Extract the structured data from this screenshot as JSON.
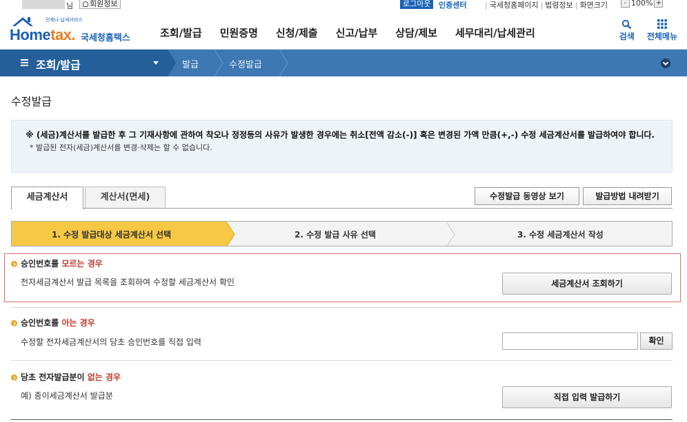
{
  "util": {
    "user_suffix": "님",
    "member_info": "회원정보",
    "logout": "로그아웃",
    "cert_center": "인증센터",
    "links": [
      "국세청홈페이지",
      "법령정보",
      "화면크기"
    ],
    "zoom_minus": "-",
    "zoom_value": "100%",
    "zoom_plus": "+"
  },
  "header": {
    "logo_tag": "언제나 납세서비스",
    "logo_main": "Home",
    "logo_dot": "tax.",
    "logo_korean": "국세청홈택스",
    "nav": [
      "조회/발급",
      "민원증명",
      "신청/제출",
      "신고/납부",
      "상담/제보",
      "세무대리/납세관리"
    ],
    "search_label": "검색",
    "allmenu_label": "전체메뉴"
  },
  "location": {
    "menu": "조회/발급",
    "crumbs": [
      "발급",
      "수정발급"
    ]
  },
  "page": {
    "title": "수정발급",
    "notice_line1": "※ (세금)계산서를 발급한 후 그 기재사항에 관하여 착오나 정정등의 사유가 발생한 경우에는 취소[전액 감소(-)] 혹은 변경된 가액 만큼(+,-) 수정 세금계산서를 발급하여야 합니다.",
    "notice_line2": "* 발급된 전자(세금)계산서를 변경·삭제는 할 수 없습니다."
  },
  "tabs": [
    "세금계산서",
    "계산서(면세)"
  ],
  "buttons": {
    "video": "수정발급 동영상 보기",
    "download": "발급방법 내려받기"
  },
  "steps": [
    "1. 수정 발급대상 세금계산서 선택",
    "2. 수정 발급 사유 선택",
    "3. 수정 세금계산서 작성"
  ],
  "sections": {
    "unknown": {
      "head_prefix": "승인번호를 ",
      "head_em": "모르는 경우",
      "desc": "전자세금계산서 발급 목록을 조회하여 수정할 세금계산서 확인",
      "button": "세금계산서 조회하기"
    },
    "known": {
      "head_prefix": "승인번호를 ",
      "head_em": "아는 경우",
      "desc": "수정할 전자세금계산서의 당초 승인번호를 직접 입력",
      "input_value": "",
      "button": "확인"
    },
    "none": {
      "head_prefix": "당초 전자발급분이 ",
      "head_em": "없는 경우",
      "desc": "예) 종이세금계산서 발급분",
      "button": "직접 입력 발급하기"
    }
  },
  "colors": {
    "brand_blue": "#1a63b6",
    "location_bar": "#3e78b2",
    "active_step": "#f7c843",
    "emphasis_red": "#c0392b",
    "highlight_border": "#e26b6b"
  }
}
